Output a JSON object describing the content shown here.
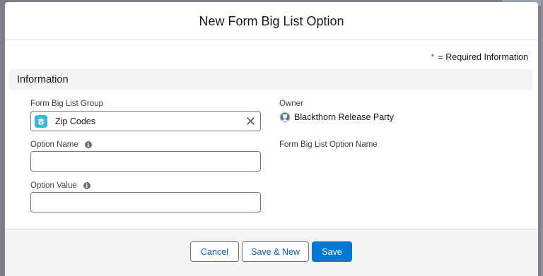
{
  "modal": {
    "title": "New Form Big List Option"
  },
  "required_note": {
    "star": "*",
    "text": "= Required Information"
  },
  "section": {
    "title": "Information"
  },
  "fields": {
    "group": {
      "label": "Form Big List Group",
      "value": "Zip Codes",
      "icon": "record-group-icon"
    },
    "option_name": {
      "label": "Option Name",
      "value": "",
      "placeholder": ""
    },
    "option_value": {
      "label": "Option Value",
      "value": "",
      "placeholder": ""
    },
    "owner": {
      "label": "Owner",
      "value": "Blackthorn Release Party",
      "icon": "user-avatar-icon"
    },
    "option_name_display": {
      "label": "Form Big List Option Name"
    }
  },
  "footer": {
    "cancel_label": "Cancel",
    "save_new_label": "Save & New",
    "save_label": "Save"
  },
  "colors": {
    "brand": "#0176d3",
    "required": "#c23934",
    "lookup_icon_bg": "#3ab6d8"
  }
}
